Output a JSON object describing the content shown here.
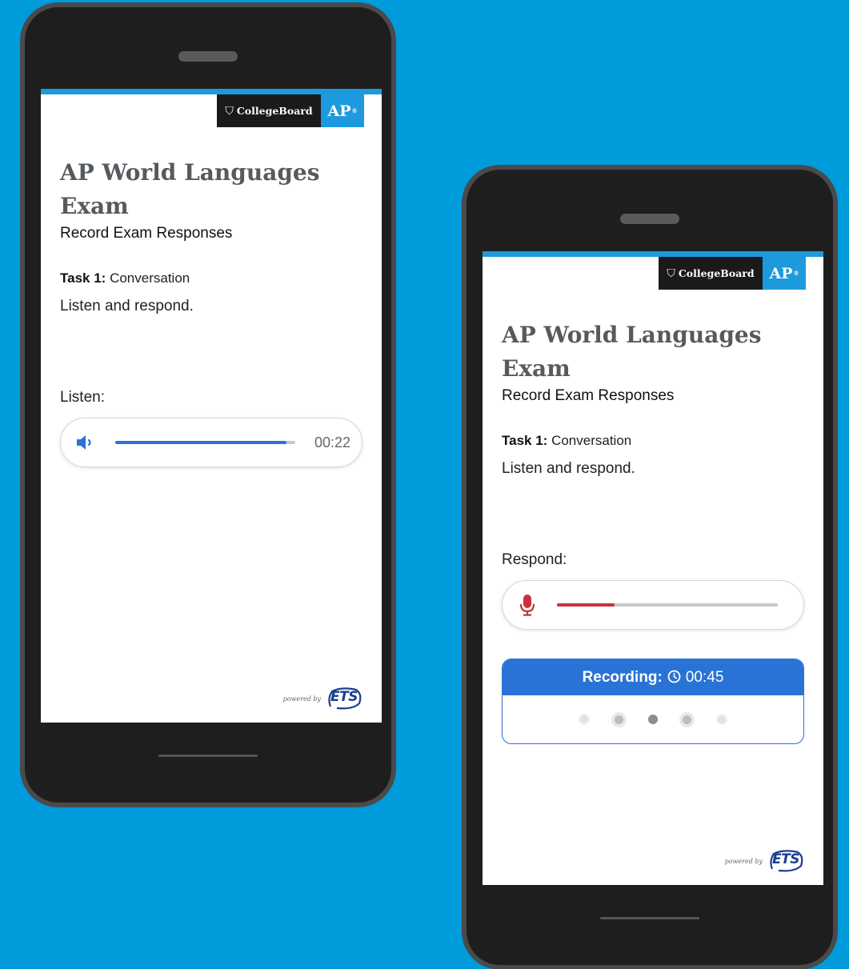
{
  "brand": {
    "collegeboard_label": "CollegeBoard",
    "ap_label": "AP",
    "ap_mark": "®",
    "powered_by": "powered by",
    "ets_label": "ETS"
  },
  "colors": {
    "background": "#009bdb",
    "brand_blue": "#1d9add",
    "player_blue": "#2a73d6",
    "record_red": "#c8323b"
  },
  "screens": [
    {
      "title": "AP World Languages Exam",
      "subtitle": "Record Exam Responses",
      "task_label": "Task 1:",
      "task_name": "Conversation",
      "instruction": "Listen and respond.",
      "section_label": "Listen:",
      "player": {
        "icon": "speaker-icon",
        "progress_percent": 95,
        "time": "00:22"
      }
    },
    {
      "title": "AP World Languages Exam",
      "subtitle": "Record Exam Responses",
      "task_label": "Task 1:",
      "task_name": "Conversation",
      "instruction": "Listen and respond.",
      "section_label": "Respond:",
      "recorder": {
        "icon": "microphone-icon",
        "progress_percent": 26
      },
      "recording": {
        "label": "Recording:",
        "icon": "clock-icon",
        "time": "00:45"
      }
    }
  ]
}
